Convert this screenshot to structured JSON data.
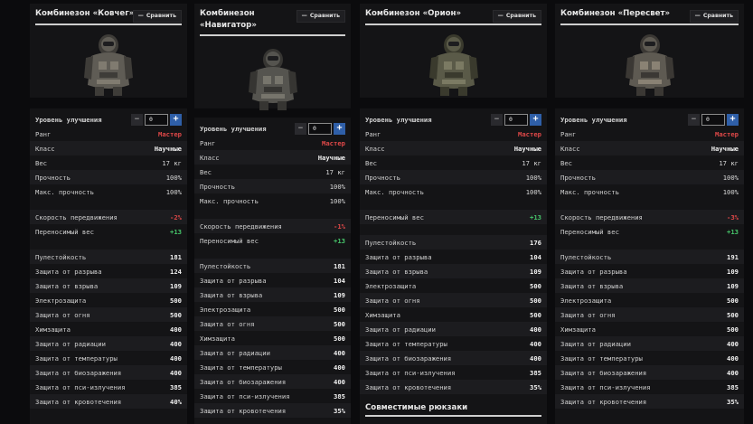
{
  "compare_label": "Сравнить",
  "cards": [
    {
      "title_lines": [
        "Комбинезон «Ковчег»"
      ],
      "upgrade_label": "Уровень улучшения",
      "upgrade_value": "0",
      "rows": [
        {
          "label": "Ранг",
          "value": "Мастер",
          "style": "red"
        },
        {
          "label": "Класс",
          "value": "Научные",
          "style": "b"
        },
        {
          "label": "Вес",
          "value": "17 кг",
          "style": ""
        },
        {
          "label": "Прочность",
          "value": "100%",
          "style": ""
        },
        {
          "label": "Макс. прочность",
          "value": "100%",
          "style": ""
        },
        {
          "gap": true
        },
        {
          "label": "Скорость передвижения",
          "value": "-2%",
          "style": "red"
        },
        {
          "label": "Переносимый вес",
          "value": "+13",
          "style": "green"
        },
        {
          "gap": true
        },
        {
          "label": "Пулестойкость",
          "value": "181",
          "style": "b"
        },
        {
          "label": "Защита от разрыва",
          "value": "124",
          "style": "b"
        },
        {
          "label": "Защита от взрыва",
          "value": "109",
          "style": "b"
        },
        {
          "label": "Электрозащита",
          "value": "500",
          "style": "b"
        },
        {
          "label": "Защита от огня",
          "value": "500",
          "style": "b"
        },
        {
          "label": "Химзащита",
          "value": "400",
          "style": "b"
        },
        {
          "label": "Защита от радиации",
          "value": "400",
          "style": "b"
        },
        {
          "label": "Защита от температуры",
          "value": "400",
          "style": "b"
        },
        {
          "label": "Защита от биозаражения",
          "value": "400",
          "style": "b"
        },
        {
          "label": "Защита от пси-излучения",
          "value": "385",
          "style": "b"
        },
        {
          "label": "Защита от кровотечения",
          "value": "40%",
          "style": "b"
        }
      ]
    },
    {
      "title_lines": [
        "Комбинезон",
        "«Навигатор»"
      ],
      "upgrade_label": "Уровень улучшения",
      "upgrade_value": "0",
      "rows": [
        {
          "label": "Ранг",
          "value": "Мастер",
          "style": "red"
        },
        {
          "label": "Класс",
          "value": "Научные",
          "style": "b"
        },
        {
          "label": "Вес",
          "value": "17 кг",
          "style": ""
        },
        {
          "label": "Прочность",
          "value": "100%",
          "style": ""
        },
        {
          "label": "Макс. прочность",
          "value": "100%",
          "style": ""
        },
        {
          "gap": true
        },
        {
          "label": "Скорость передвижения",
          "value": "-1%",
          "style": "red"
        },
        {
          "label": "Переносимый вес",
          "value": "+13",
          "style": "green"
        },
        {
          "gap": true
        },
        {
          "label": "Пулестойкость",
          "value": "181",
          "style": "b"
        },
        {
          "label": "Защита от разрыва",
          "value": "104",
          "style": "b"
        },
        {
          "label": "Защита от взрыва",
          "value": "109",
          "style": "b"
        },
        {
          "label": "Электрозащита",
          "value": "500",
          "style": "b"
        },
        {
          "label": "Защита от огня",
          "value": "500",
          "style": "b"
        },
        {
          "label": "Химзащита",
          "value": "500",
          "style": "b"
        },
        {
          "label": "Защита от радиации",
          "value": "400",
          "style": "b"
        },
        {
          "label": "Защита от температуры",
          "value": "400",
          "style": "b"
        },
        {
          "label": "Защита от биозаражения",
          "value": "400",
          "style": "b"
        },
        {
          "label": "Защита от пси-излучения",
          "value": "385",
          "style": "b"
        },
        {
          "label": "Защита от кровотечения",
          "value": "35%",
          "style": "b"
        }
      ]
    },
    {
      "title_lines": [
        "Комбинезон «Орион»"
      ],
      "upgrade_label": "Уровень улучшения",
      "upgrade_value": "0",
      "rows": [
        {
          "label": "Ранг",
          "value": "Мастер",
          "style": "red"
        },
        {
          "label": "Класс",
          "value": "Научные",
          "style": "b"
        },
        {
          "label": "Вес",
          "value": "17 кг",
          "style": ""
        },
        {
          "label": "Прочность",
          "value": "100%",
          "style": ""
        },
        {
          "label": "Макс. прочность",
          "value": "100%",
          "style": ""
        },
        {
          "gap": true
        },
        {
          "label": "Переносимый вес",
          "value": "+13",
          "style": "green"
        },
        {
          "gap": true
        },
        {
          "label": "Пулестойкость",
          "value": "176",
          "style": "b"
        },
        {
          "label": "Защита от разрыва",
          "value": "104",
          "style": "b"
        },
        {
          "label": "Защита от взрыва",
          "value": "109",
          "style": "b"
        },
        {
          "label": "Электрозащита",
          "value": "500",
          "style": "b"
        },
        {
          "label": "Защита от огня",
          "value": "500",
          "style": "b"
        },
        {
          "label": "Химзащита",
          "value": "500",
          "style": "b"
        },
        {
          "label": "Защита от радиации",
          "value": "400",
          "style": "b"
        },
        {
          "label": "Защита от температуры",
          "value": "400",
          "style": "b"
        },
        {
          "label": "Защита от биозаражения",
          "value": "400",
          "style": "b"
        },
        {
          "label": "Защита от пси-излучения",
          "value": "385",
          "style": "b"
        },
        {
          "label": "Защита от кровотечения",
          "value": "35%",
          "style": "b"
        }
      ],
      "extra_title": "Совместимые рюкзаки"
    },
    {
      "title_lines": [
        "Комбинезон «Пересвет»"
      ],
      "upgrade_label": "Уровень улучшения",
      "upgrade_value": "0",
      "rows": [
        {
          "label": "Ранг",
          "value": "Мастер",
          "style": "red"
        },
        {
          "label": "Класс",
          "value": "Научные",
          "style": "b"
        },
        {
          "label": "Вес",
          "value": "17 кг",
          "style": ""
        },
        {
          "label": "Прочность",
          "value": "100%",
          "style": ""
        },
        {
          "label": "Макс. прочность",
          "value": "100%",
          "style": ""
        },
        {
          "gap": true
        },
        {
          "label": "Скорость передвижения",
          "value": "-3%",
          "style": "red"
        },
        {
          "label": "Переносимый вес",
          "value": "+13",
          "style": "green"
        },
        {
          "gap": true
        },
        {
          "label": "Пулестойкость",
          "value": "191",
          "style": "b"
        },
        {
          "label": "Защита от разрыва",
          "value": "109",
          "style": "b"
        },
        {
          "label": "Защита от взрыва",
          "value": "109",
          "style": "b"
        },
        {
          "label": "Электрозащита",
          "value": "500",
          "style": "b"
        },
        {
          "label": "Защита от огня",
          "value": "500",
          "style": "b"
        },
        {
          "label": "Химзащита",
          "value": "500",
          "style": "b"
        },
        {
          "label": "Защита от радиации",
          "value": "400",
          "style": "b"
        },
        {
          "label": "Защита от температуры",
          "value": "400",
          "style": "b"
        },
        {
          "label": "Защита от биозаражения",
          "value": "400",
          "style": "b"
        },
        {
          "label": "Защита от пси-излучения",
          "value": "385",
          "style": "b"
        },
        {
          "label": "Защита от кровотечения",
          "value": "35%",
          "style": "b"
        }
      ]
    }
  ]
}
